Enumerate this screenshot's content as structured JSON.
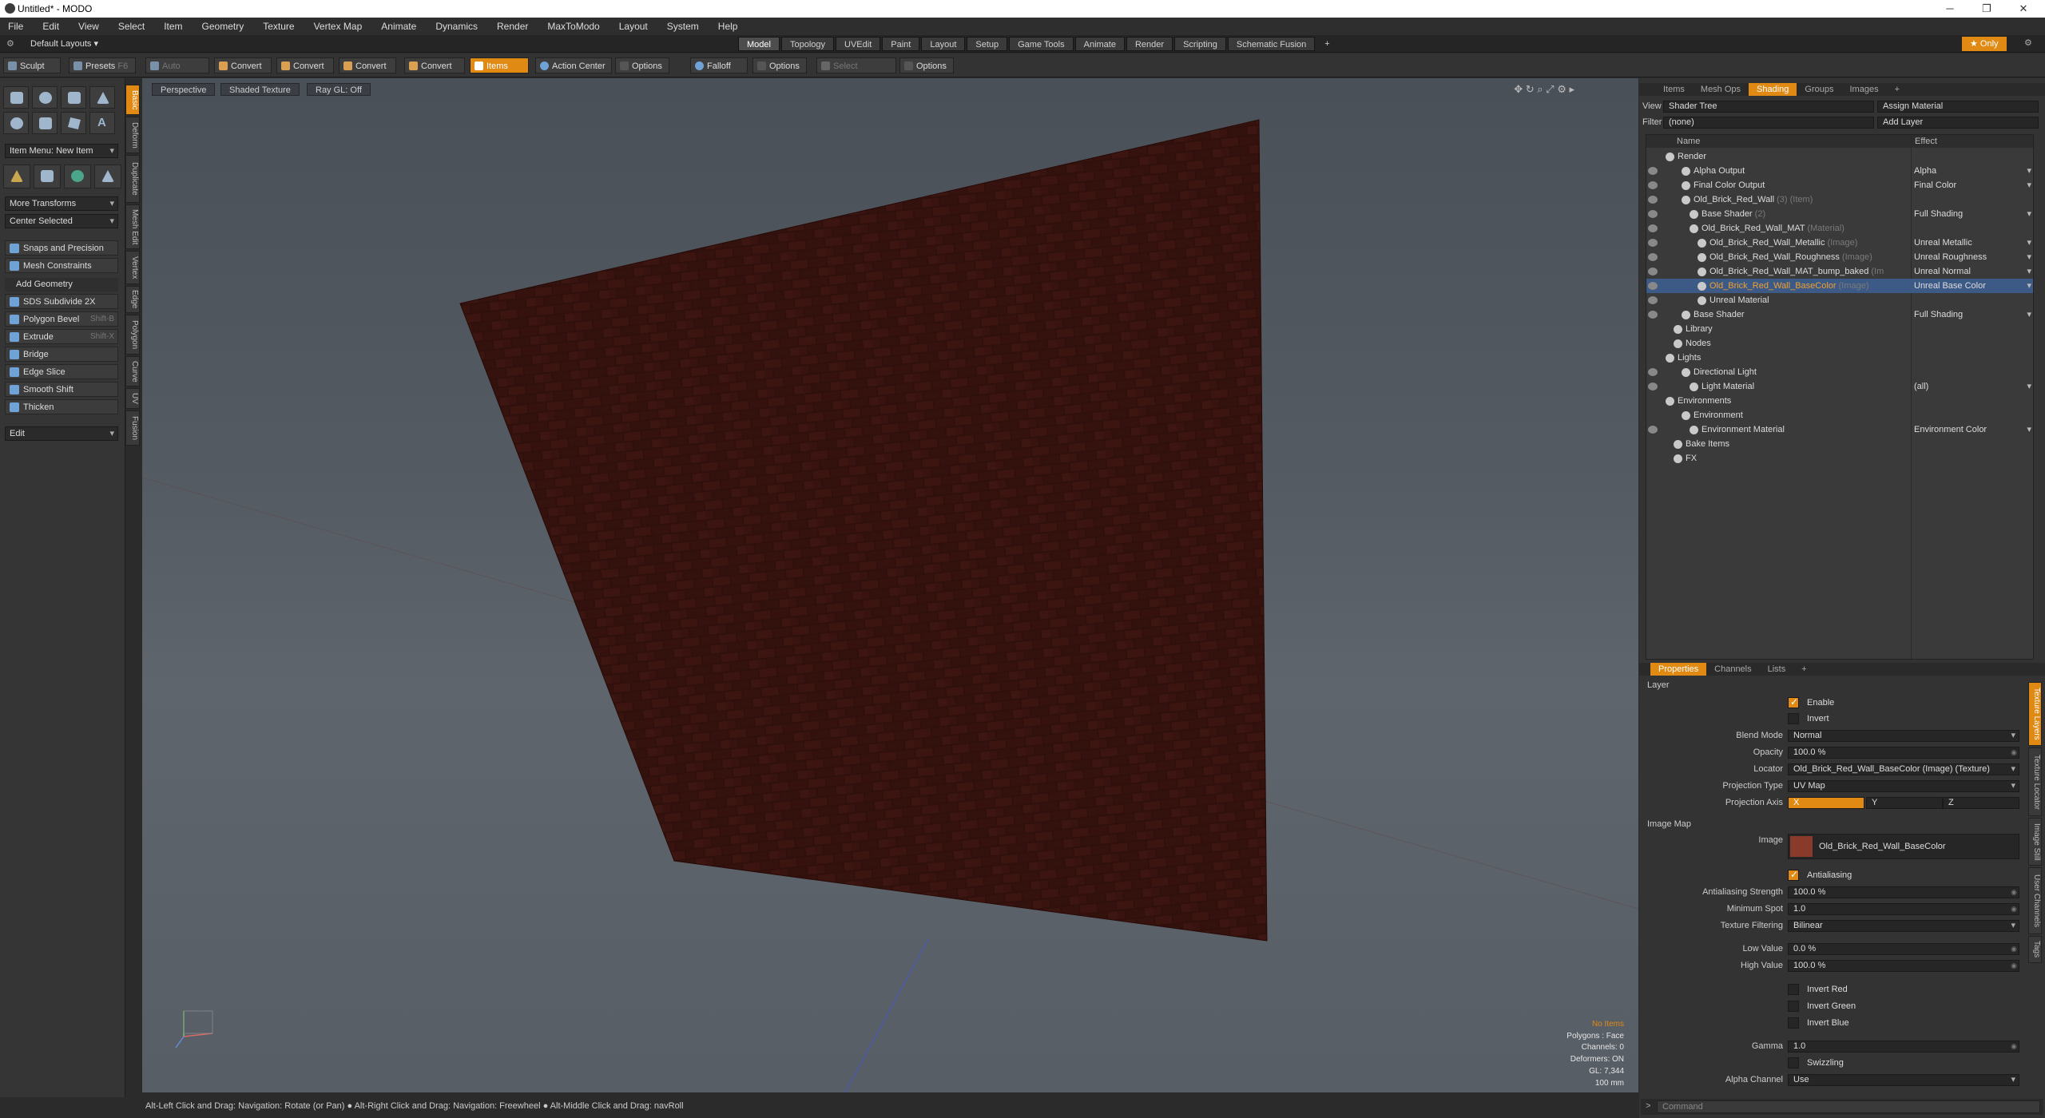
{
  "window": {
    "title": "Untitled* - MODO",
    "min": "─",
    "max": "❐",
    "close": "✕"
  },
  "menu": [
    "File",
    "Edit",
    "View",
    "Select",
    "Item",
    "Geometry",
    "Texture",
    "Vertex Map",
    "Animate",
    "Dynamics",
    "Render",
    "MaxToModo",
    "Layout",
    "System",
    "Help"
  ],
  "layoutbar": {
    "layout": "Default Layouts ▾",
    "tabs": [
      "Model",
      "Topology",
      "UVEdit",
      "Paint",
      "Layout",
      "Setup",
      "Game Tools",
      "Animate",
      "Render",
      "Scripting",
      "Schematic Fusion"
    ],
    "active_tab": "Model",
    "plus": "+",
    "only": "★ Only"
  },
  "toolbar": {
    "sculpt": "Sculpt",
    "presets": "Presets",
    "presets_key": "F6",
    "auto_select": "Auto Select",
    "convert": "Convert",
    "items": "Items",
    "action_center": "Action Center",
    "options": "Options",
    "falloff": "Falloff",
    "select_through": "Select Through"
  },
  "lefttool": {
    "item_menu": "Item Menu: New Item",
    "more_transforms": "More Transforms",
    "center_selected": "Center Selected",
    "snaps": "Snaps and Precision",
    "mesh_constraints": "Mesh Constraints",
    "add_geometry": "Add Geometry",
    "tools": [
      {
        "label": "SDS Subdivide 2X",
        "key": ""
      },
      {
        "label": "Polygon Bevel",
        "key": "Shift-B"
      },
      {
        "label": "Extrude",
        "key": "Shift-X"
      },
      {
        "label": "Bridge",
        "key": ""
      },
      {
        "label": "Edge Slice",
        "key": ""
      },
      {
        "label": "Smooth Shift",
        "key": ""
      },
      {
        "label": "Thicken",
        "key": ""
      }
    ],
    "edit": "Edit"
  },
  "vtabs": [
    "Basic",
    "Deform",
    "Duplicate",
    "Mesh Edit",
    "Vertex",
    "Edge",
    "Polygon",
    "Curve",
    "UV",
    "Fusion"
  ],
  "viewport": {
    "perspective": "Perspective",
    "shaded": "Shaded Texture",
    "raygl": "Ray GL: Off",
    "hud": [
      "No Items",
      "Polygons : Face",
      "Channels: 0",
      "Deformers: ON",
      "GL: 7,344",
      "100 mm"
    ]
  },
  "status": "Alt-Left Click and Drag: Navigation: Rotate (or Pan) ● Alt-Right Click and Drag: Navigation: Freewheel ● Alt-Middle Click and Drag: navRoll",
  "shading": {
    "tabs": [
      "Items",
      "Mesh Ops",
      "Shading",
      "Groups",
      "Images",
      "+"
    ],
    "active_tab": "Shading",
    "view_label": "View",
    "view_value": "Shader Tree",
    "assign": "Assign Material",
    "filter_label": "Filter",
    "filter_value": "(none)",
    "add_layer": "Add Layer",
    "col_name": "Name",
    "col_effect": "Effect",
    "rows": [
      {
        "name": "Render",
        "sub": "",
        "effect": "",
        "indent": 0,
        "eye": false,
        "sel": false
      },
      {
        "name": "Alpha Output",
        "sub": "",
        "effect": "Alpha",
        "indent": 2,
        "eye": true,
        "sel": false
      },
      {
        "name": "Final Color Output",
        "sub": "",
        "effect": "Final Color",
        "indent": 2,
        "eye": true,
        "sel": false
      },
      {
        "name": "Old_Brick_Red_Wall",
        "sub": " (3) (Item)",
        "effect": "",
        "indent": 2,
        "eye": true,
        "sel": false
      },
      {
        "name": "Base Shader",
        "sub": " (2)",
        "effect": "Full Shading",
        "indent": 3,
        "eye": true,
        "sel": false
      },
      {
        "name": "Old_Brick_Red_Wall_MAT",
        "sub": " (Material)",
        "effect": "",
        "indent": 3,
        "eye": true,
        "sel": false
      },
      {
        "name": "Old_Brick_Red_Wall_Metallic",
        "sub": " (Image)",
        "effect": "Unreal Metallic",
        "indent": 4,
        "eye": true,
        "sel": false
      },
      {
        "name": "Old_Brick_Red_Wall_Roughness",
        "sub": " (Image)",
        "effect": "Unreal Roughness",
        "indent": 4,
        "eye": true,
        "sel": false
      },
      {
        "name": "Old_Brick_Red_Wall_MAT_bump_baked",
        "sub": " (Im",
        "effect": "Unreal Normal",
        "indent": 4,
        "eye": true,
        "sel": false
      },
      {
        "name": "Old_Brick_Red_Wall_BaseColor",
        "sub": " (Image)",
        "effect": "Unreal Base Color",
        "indent": 4,
        "eye": true,
        "sel": true
      },
      {
        "name": "Unreal Material",
        "sub": "",
        "effect": "",
        "indent": 4,
        "eye": true,
        "sel": false
      },
      {
        "name": "Base Shader",
        "sub": "",
        "effect": "Full Shading",
        "indent": 2,
        "eye": true,
        "sel": false
      },
      {
        "name": "Library",
        "sub": "",
        "effect": "",
        "indent": 1,
        "eye": false,
        "sel": false
      },
      {
        "name": "Nodes",
        "sub": "",
        "effect": "",
        "indent": 1,
        "eye": false,
        "sel": false
      },
      {
        "name": "Lights",
        "sub": "",
        "effect": "",
        "indent": 0,
        "eye": false,
        "sel": false
      },
      {
        "name": "Directional Light",
        "sub": "",
        "effect": "",
        "indent": 2,
        "eye": true,
        "sel": false
      },
      {
        "name": "Light Material",
        "sub": "",
        "effect": "(all)",
        "indent": 3,
        "eye": true,
        "sel": false
      },
      {
        "name": "Environments",
        "sub": "",
        "effect": "",
        "indent": 0,
        "eye": false,
        "sel": false
      },
      {
        "name": "Environment",
        "sub": "",
        "effect": "",
        "indent": 2,
        "eye": false,
        "sel": false
      },
      {
        "name": "Environment Material",
        "sub": "",
        "effect": "Environment Color",
        "indent": 3,
        "eye": true,
        "sel": false
      },
      {
        "name": "Bake Items",
        "sub": "",
        "effect": "",
        "indent": 1,
        "eye": false,
        "sel": false
      },
      {
        "name": "FX",
        "sub": "",
        "effect": "",
        "indent": 1,
        "eye": false,
        "sel": false
      }
    ]
  },
  "properties": {
    "tabs": [
      "Properties",
      "Channels",
      "Lists",
      "+"
    ],
    "active_tab": "Properties",
    "layer_section": "Layer",
    "enable": "Enable",
    "invert": "Invert",
    "blend_mode_label": "Blend Mode",
    "blend_mode": "Normal",
    "opacity_label": "Opacity",
    "opacity": "100.0 %",
    "locator_label": "Locator",
    "locator": "Old_Brick_Red_Wall_BaseColor (Image) (Texture)",
    "projection_type_label": "Projection Type",
    "projection_type": "UV Map",
    "projection_axis_label": "Projection Axis",
    "axis_x": "X",
    "axis_y": "Y",
    "axis_z": "Z",
    "image_map_section": "Image Map",
    "image_label": "Image",
    "image_value": "Old_Brick_Red_Wall_BaseColor",
    "antialiasing": "Antialiasing",
    "aa_strength_label": "Antialiasing Strength",
    "aa_strength": "100.0 %",
    "min_spot_label": "Minimum Spot",
    "min_spot": "1.0",
    "tex_filter_label": "Texture Filtering",
    "tex_filter": "Bilinear",
    "low_label": "Low Value",
    "low": "0.0 %",
    "high_label": "High Value",
    "high": "100.0 %",
    "invert_red": "Invert Red",
    "invert_green": "Invert Green",
    "invert_blue": "Invert Blue",
    "gamma_label": "Gamma",
    "gamma": "1.0",
    "swizzling": "Swizzling",
    "alpha_label": "Alpha Channel",
    "alpha": "Use"
  },
  "rvtabs": [
    "Texture Layers",
    "Texture Locator",
    "Image Still",
    "User Channels",
    "Tags"
  ],
  "command_placeholder": "Command"
}
